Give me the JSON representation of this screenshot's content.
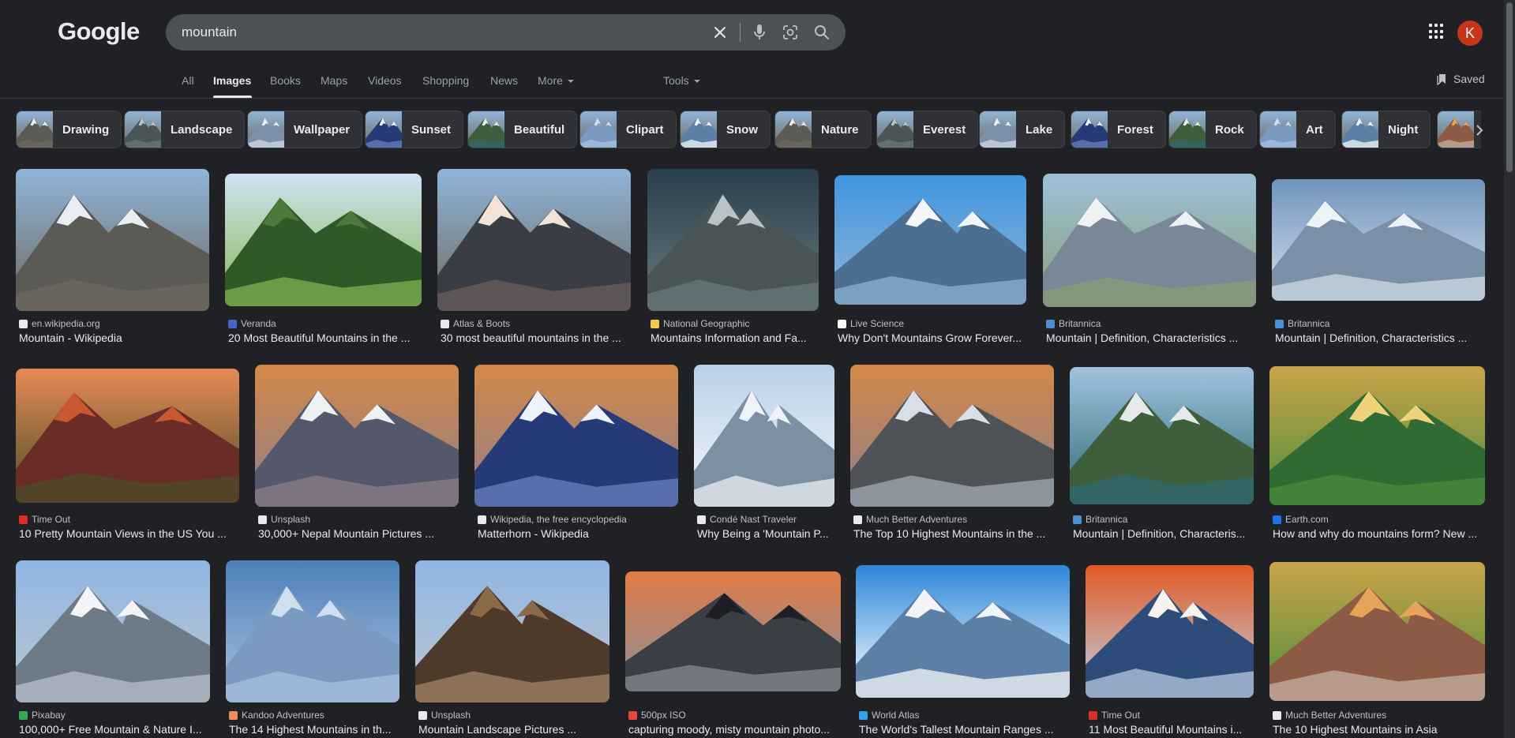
{
  "logo": "Google",
  "search": {
    "value": "mountain"
  },
  "avatar_letter": "K",
  "tabs": [
    "All",
    "Images",
    "Books",
    "Maps",
    "Videos",
    "Shopping",
    "News",
    "More",
    "Tools"
  ],
  "saved_label": "Saved",
  "chips": [
    "Drawing",
    "Landscape",
    "Wallpaper",
    "Sunset",
    "Beautiful",
    "Clipart",
    "Snow",
    "Nature",
    "Everest",
    "Lake",
    "Forest",
    "Rock",
    "Art",
    "Night"
  ],
  "results": [
    [
      {
        "source": "en.wikipedia.org",
        "title": "Mountain - Wikipedia"
      },
      {
        "source": "Veranda",
        "title": "20 Most Beautiful Mountains in the ..."
      },
      {
        "source": "Atlas & Boots",
        "title": "30 most beautiful mountains in the ..."
      },
      {
        "source": "National Geographic",
        "title": "Mountains Information and Fa..."
      },
      {
        "source": "Live Science",
        "title": "Why Don't Mountains Grow Forever..."
      },
      {
        "source": "Britannica",
        "title": "Mountain | Definition, Characteristics ..."
      },
      {
        "source": "Britannica",
        "title": "Mountain | Definition, Characteristics ..."
      }
    ],
    [
      {
        "source": "Time Out",
        "title": "10 Pretty Mountain Views in the US You ..."
      },
      {
        "source": "Unsplash",
        "title": "30,000+ Nepal Mountain Pictures ..."
      },
      {
        "source": "Wikipedia, the free encyclopedia",
        "title": "Matterhorn - Wikipedia"
      },
      {
        "source": "Condé Nast Traveler",
        "title": "Why Being a 'Mountain P..."
      },
      {
        "source": "Much Better Adventures",
        "title": "The Top 10 Highest Mountains in the ..."
      },
      {
        "source": "Britannica",
        "title": "Mountain | Definition, Characteris..."
      },
      {
        "source": "Earth.com",
        "title": "How and why do mountains form? New ..."
      }
    ],
    [
      {
        "source": "Pixabay",
        "title": "100,000+ Free Mountain & Nature I..."
      },
      {
        "source": "Kandoo Adventures",
        "title": "The 14 Highest Mountains in th..."
      },
      {
        "source": "Unsplash",
        "title": "Mountain Landscape Pictures ..."
      },
      {
        "source": "500px ISO",
        "title": "capturing moody, misty mountain photo..."
      },
      {
        "source": "World Atlas",
        "title": "The World's Tallest Mountain Ranges ..."
      },
      {
        "source": "Time Out",
        "title": "11 Most Beautiful Mountains i..."
      },
      {
        "source": "Much Better Adventures",
        "title": "The 10 Highest Mountains in Asia"
      }
    ]
  ]
}
